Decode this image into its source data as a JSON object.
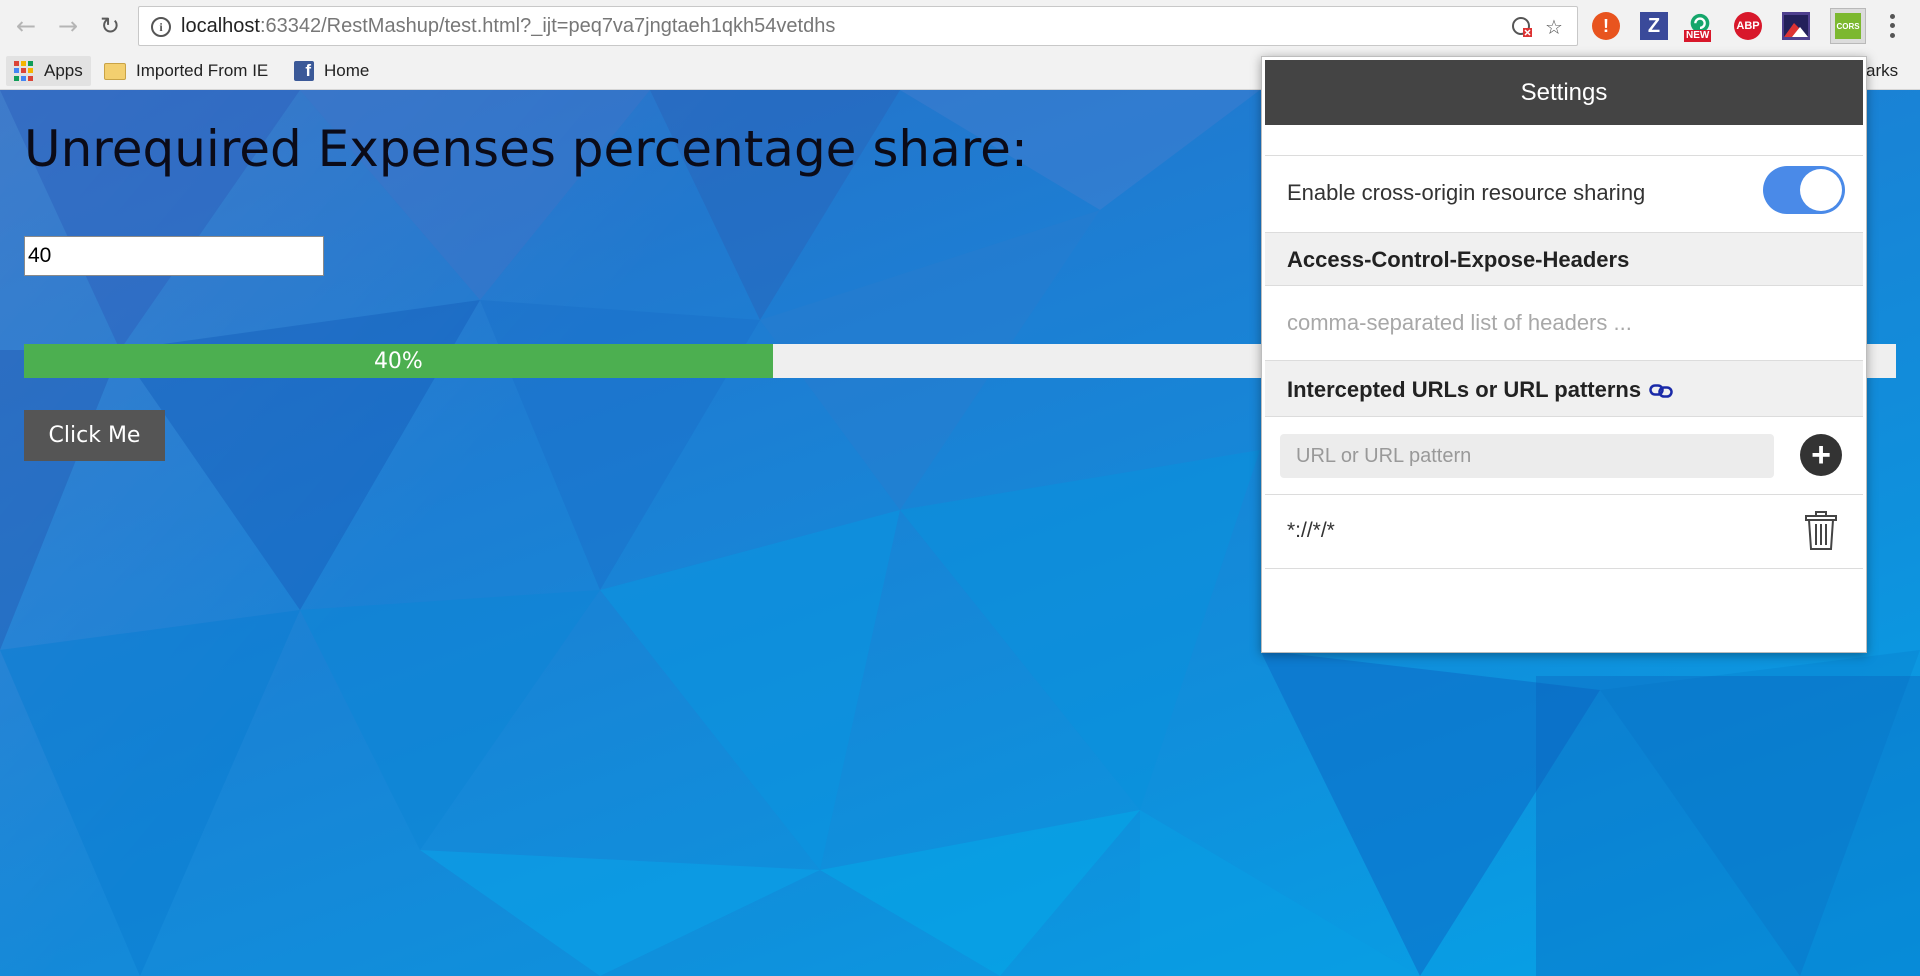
{
  "browser": {
    "url_host": "localhost",
    "url_rest": ":63342/RestMashup/test.html?_ijt=peq7va7jngtaeh1qkh54vetdhs",
    "extensions": [
      {
        "name": "alert-extension-icon",
        "label": "!",
        "color": "#e8541f"
      },
      {
        "name": "zotero-extension-icon",
        "label": "Z",
        "color": "#3a4a9a"
      },
      {
        "name": "grammarly-extension-icon",
        "label": "NEW",
        "color": "#15a66b"
      },
      {
        "name": "adblock-plus-extension-icon",
        "label": "ABP",
        "color": "#d8182b"
      },
      {
        "name": "image-extension-icon",
        "label": "",
        "color": "#4e3f8e"
      },
      {
        "name": "cors-extension-icon",
        "label": "CORS",
        "color": "#7cb82f"
      }
    ],
    "bookmarks": {
      "apps": "Apps",
      "imported": "Imported From IE",
      "home": "Home",
      "other_partial": "arks"
    }
  },
  "page": {
    "heading": "Unrequired Expenses percentage share:",
    "input_value": "40",
    "progress": {
      "percent": 40,
      "label": "40%"
    },
    "button_label": "Click Me"
  },
  "popup": {
    "title": "Settings",
    "cors_label": "Enable cross-origin resource sharing",
    "cors_enabled": true,
    "expose_headers_title": "Access-Control-Expose-Headers",
    "expose_headers_placeholder": "comma-separated list of headers ...",
    "intercepted_title": "Intercepted URLs or URL patterns",
    "url_placeholder": "URL or URL pattern",
    "patterns": [
      "*://*/*"
    ]
  },
  "colors": {
    "accent_toggle": "#4a8ae8",
    "progress_fill": "#4caf50",
    "button_bg": "#555555",
    "popup_header": "#444444"
  }
}
